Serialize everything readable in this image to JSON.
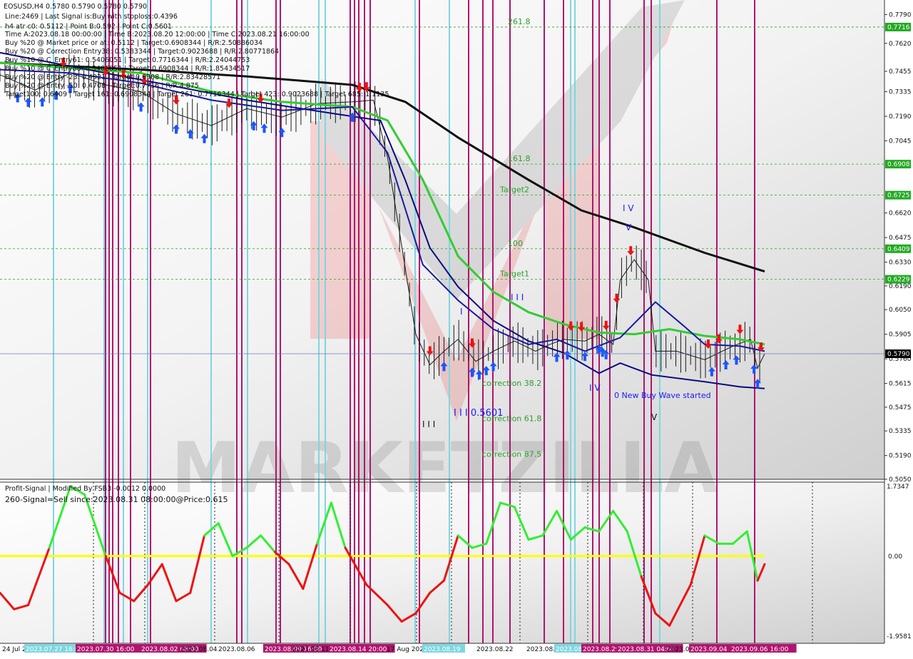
{
  "main_info": {
    "symbol_line": "EOSUSD,H4  0.5780 0.5790 0.5780 0.5790",
    "lines": [
      "Line:2469 | Last Signal is:Buy with stoploss:0.4396",
      "h4 atr c0: 0.5112 | Point B:0.592 | Point C:0.5601",
      "Time A:2023.08.18 00:00:00 | Time B:2023.08.20 12:00:00 | Time C:2023.08.21 16:00:00",
      "Buy %20 @ Market price or at: 0.5112 | Target:0.6908344 | R/R:2.50886034",
      "Buy %20 @ Correction Entry38: 0.5383344 | Target:0.9023688 | R/R:2.80771864",
      "Buy %10 @ C_Entry61: 0.5406051 | Target:0.7716344 | R/R:2.24044753",
      "Buy %10 @ C_Entry88: 0.5406051 | Target:0.6908344 | R/R:1.85434517",
      "Buy %20 @ Entry -23: 0.4921 | Target:0.6908 | R/R:2.83428571",
      "Buy %20 @ Entry -50: 0.4708 | Target:0.7716 | R/R:4.875",
      "Target100: 0.6409 | Target 161: 0.6908344 | Target 261: 0.7716344 | Target 423: 0.9023688 | Target 685: 1.1135"
    ]
  },
  "price_axis": {
    "labels": [
      "0.7790",
      "0.7620",
      "0.7455",
      "0.7335",
      "0.7190",
      "0.7045",
      "0.6620",
      "0.6475",
      "0.6330",
      "0.6190",
      "0.6050",
      "0.5905",
      "0.5760",
      "0.5615",
      "0.5475",
      "0.5335",
      "0.5190",
      "0.5050"
    ],
    "boxes": [
      {
        "label": "0.7716",
        "price": 0.7716,
        "color": "#22aa22"
      },
      {
        "label": "0.6908",
        "price": 0.6908,
        "color": "#22aa22"
      },
      {
        "label": "0.6725",
        "price": 0.6725,
        "color": "#22aa22"
      },
      {
        "label": "0.6409",
        "price": 0.6409,
        "color": "#22aa22"
      },
      {
        "label": "0.6229",
        "price": 0.6229,
        "color": "#22aa22"
      },
      {
        "label": "0.5790",
        "price": 0.579,
        "color": "#000000"
      }
    ]
  },
  "levels": [
    {
      "label": "261.8",
      "price": 0.7716
    },
    {
      "label": "161.8",
      "price": 0.6908
    },
    {
      "label": "Target2",
      "price": 0.6725
    },
    {
      "label": "100",
      "price": 0.6409
    },
    {
      "label": "Target1",
      "price": 0.6229
    },
    {
      "label": "correction 38.2",
      "price": 0.5583
    },
    {
      "label": "correction 61.8",
      "price": 0.5376
    },
    {
      "label": "correction 87.5",
      "price": 0.5165
    }
  ],
  "wave_labels": [
    "I V",
    "V",
    "I I I",
    "I",
    "I I I",
    "I I I 0.5601",
    "I V",
    "0 New Buy Wave started",
    "V"
  ],
  "watermark": "MARKETZILLA",
  "sub_info": {
    "title": "Profit-Signal | Modified By FSB3 -0.0012 0.0000",
    "signal": "260-Signal=Sell since:2023.08.31 08:00:00@Price:0.615"
  },
  "sub_axis": {
    "labels": [
      "1.7347",
      "0.00",
      "-1.9581"
    ]
  },
  "time_axis": {
    "labels": [
      "24 Jul 2023",
      "2023.07.27 16:00",
      "2023.07.30 16:00",
      "2023.08.02 08:00",
      "2023.08.04",
      "2023.08.06",
      "2023.08.09 16:00",
      "2023.08.11",
      "2023.08.14 20:00",
      "17 Aug 2023",
      "2023.08.19",
      "2023.08.22",
      "2023.08.24",
      "2023.08.26",
      "2023.08.29",
      "2023.08.31 04:00",
      "2023.09.02",
      "2023.09.04",
      "2023.09.06 16:00"
    ]
  },
  "colors": {
    "ma_black": "#111111",
    "ma_green": "#33cc33",
    "ma_navy": "#0a0a80",
    "ma_blue": "#1a1aa0",
    "level_green": "#2ca02c",
    "buy_arrow": "#1a55ff",
    "sell_arrow": "#ee1111",
    "vline_magenta": "#b0156f",
    "vline_cyan": "#7fd6e0",
    "osc_up": "#33ee33",
    "osc_down": "#ee1111",
    "osc_zero": "#ffff00",
    "wave_blue": "#1a1aff"
  },
  "chart_data": {
    "type": "line",
    "title": "EOSUSD,H4",
    "xlabel": "",
    "ylabel": "",
    "ylim": [
      0.505,
      0.7825
    ],
    "x_range": [
      0,
      217
    ],
    "current_price": 0.579,
    "series": [
      {
        "key": "ma_slow",
        "points": [
          [
            0,
            0.7505
          ],
          [
            40,
            0.7465
          ],
          [
            70,
            0.7425
          ],
          [
            100,
            0.7375
          ],
          [
            115,
            0.7275
          ],
          [
            130,
            0.7065
          ],
          [
            150,
            0.6815
          ],
          [
            165,
            0.6635
          ],
          [
            180,
            0.6535
          ],
          [
            200,
            0.6385
          ],
          [
            217,
            0.6275
          ]
        ]
      },
      {
        "key": "ma_green",
        "points": [
          [
            0,
            0.7505
          ],
          [
            40,
            0.7445
          ],
          [
            60,
            0.7335
          ],
          [
            80,
            0.7275
          ],
          [
            100,
            0.7245
          ],
          [
            110,
            0.7165
          ],
          [
            120,
            0.6815
          ],
          [
            130,
            0.6365
          ],
          [
            140,
            0.6155
          ],
          [
            150,
            0.6035
          ],
          [
            160,
            0.5965
          ],
          [
            170,
            0.5915
          ],
          [
            180,
            0.5905
          ],
          [
            190,
            0.5935
          ],
          [
            200,
            0.5895
          ],
          [
            210,
            0.5875
          ],
          [
            217,
            0.5845
          ]
        ]
      },
      {
        "key": "ma_navy",
        "points": [
          [
            0,
            0.7565
          ],
          [
            30,
            0.7445
          ],
          [
            50,
            0.7365
          ],
          [
            70,
            0.7285
          ],
          [
            95,
            0.7205
          ],
          [
            108,
            0.7165
          ],
          [
            115,
            0.6815
          ],
          [
            122,
            0.6415
          ],
          [
            130,
            0.6185
          ],
          [
            140,
            0.5985
          ],
          [
            150,
            0.5865
          ],
          [
            160,
            0.5795
          ],
          [
            170,
            0.5675
          ],
          [
            176,
            0.5735
          ],
          [
            185,
            0.5665
          ],
          [
            200,
            0.5625
          ],
          [
            210,
            0.5595
          ],
          [
            217,
            0.5585
          ]
        ]
      },
      {
        "key": "ma_blue",
        "points": [
          [
            0,
            0.7465
          ],
          [
            20,
            0.7445
          ],
          [
            40,
            0.7385
          ],
          [
            60,
            0.7285
          ],
          [
            80,
            0.7225
          ],
          [
            100,
            0.7245
          ],
          [
            110,
            0.6975
          ],
          [
            120,
            0.6315
          ],
          [
            130,
            0.6105
          ],
          [
            140,
            0.5935
          ],
          [
            150,
            0.5845
          ],
          [
            158,
            0.5875
          ],
          [
            166,
            0.5805
          ],
          [
            176,
            0.5885
          ],
          [
            186,
            0.6095
          ],
          [
            194,
            0.5955
          ],
          [
            200,
            0.5845
          ],
          [
            210,
            0.5835
          ],
          [
            217,
            0.5805
          ]
        ]
      },
      {
        "key": "price",
        "points": [
          [
            0,
            0.7435
          ],
          [
            10,
            0.7345
          ],
          [
            20,
            0.7445
          ],
          [
            30,
            0.7375
          ],
          [
            40,
            0.7335
          ],
          [
            50,
            0.7205
          ],
          [
            60,
            0.7135
          ],
          [
            70,
            0.7235
          ],
          [
            80,
            0.7185
          ],
          [
            90,
            0.7265
          ],
          [
            100,
            0.7275
          ],
          [
            106,
            0.7285
          ],
          [
            110,
            0.6945
          ],
          [
            114,
            0.6425
          ],
          [
            118,
            0.5905
          ],
          [
            122,
            0.5725
          ],
          [
            126,
            0.5805
          ],
          [
            130,
            0.5875
          ],
          [
            135,
            0.5745
          ],
          [
            140,
            0.5805
          ],
          [
            146,
            0.5865
          ],
          [
            152,
            0.5805
          ],
          [
            156,
            0.5845
          ],
          [
            160,
            0.5875
          ],
          [
            166,
            0.5865
          ],
          [
            170,
            0.5905
          ],
          [
            174,
            0.5845
          ],
          [
            176,
            0.6225
          ],
          [
            180,
            0.6345
          ],
          [
            184,
            0.6225
          ],
          [
            186,
            0.5805
          ],
          [
            192,
            0.5805
          ],
          [
            200,
            0.5755
          ],
          [
            208,
            0.5835
          ],
          [
            213,
            0.5875
          ],
          [
            215,
            0.5705
          ],
          [
            217,
            0.579
          ]
        ]
      }
    ],
    "buy_signals_x": [
      5,
      8,
      12,
      16,
      20,
      40,
      50,
      54,
      58,
      72,
      75,
      80,
      100,
      126,
      134,
      136,
      138,
      140,
      158,
      161,
      166,
      170,
      171,
      172,
      202,
      206,
      209,
      214,
      215
    ],
    "sell_signals_x": [
      18,
      30,
      35,
      41,
      50,
      65,
      74,
      102,
      104,
      122,
      134,
      162,
      165,
      172,
      175,
      179,
      201,
      204,
      210,
      216
    ],
    "oscillator": {
      "ylim": [
        -1.9581,
        1.7347
      ],
      "points": [
        [
          0,
          -0.9
        ],
        [
          4,
          -1.3
        ],
        [
          8,
          -1.2
        ],
        [
          14,
          0.2
        ],
        [
          20,
          1.7
        ],
        [
          24,
          1.5
        ],
        [
          30,
          0.0
        ],
        [
          34,
          -0.9
        ],
        [
          38,
          -1.1
        ],
        [
          42,
          -0.7
        ],
        [
          46,
          -0.2
        ],
        [
          50,
          -1.1
        ],
        [
          54,
          -0.9
        ],
        [
          58,
          0.5
        ],
        [
          62,
          0.8
        ],
        [
          66,
          0.0
        ],
        [
          70,
          0.2
        ],
        [
          74,
          0.5
        ],
        [
          78,
          0.1
        ],
        [
          82,
          -0.2
        ],
        [
          86,
          -0.8
        ],
        [
          90,
          0.3
        ],
        [
          94,
          1.3
        ],
        [
          98,
          0.2
        ],
        [
          104,
          -0.7
        ],
        [
          110,
          -1.2
        ],
        [
          114,
          -1.6
        ],
        [
          118,
          -1.4
        ],
        [
          122,
          -0.9
        ],
        [
          126,
          -0.6
        ],
        [
          130,
          0.5
        ],
        [
          134,
          0.2
        ],
        [
          138,
          0.3
        ],
        [
          142,
          1.3
        ],
        [
          146,
          1.2
        ],
        [
          150,
          0.4
        ],
        [
          154,
          0.5
        ],
        [
          158,
          1.1
        ],
        [
          162,
          0.4
        ],
        [
          166,
          0.7
        ],
        [
          170,
          0.6
        ],
        [
          174,
          1.1
        ],
        [
          178,
          0.6
        ],
        [
          182,
          -0.5
        ],
        [
          186,
          -1.4
        ],
        [
          190,
          -1.7
        ],
        [
          196,
          -0.7
        ],
        [
          200,
          0.5
        ],
        [
          204,
          0.3
        ],
        [
          208,
          0.3
        ],
        [
          212,
          0.6
        ],
        [
          215,
          -0.6
        ],
        [
          217,
          -0.2
        ]
      ]
    }
  }
}
